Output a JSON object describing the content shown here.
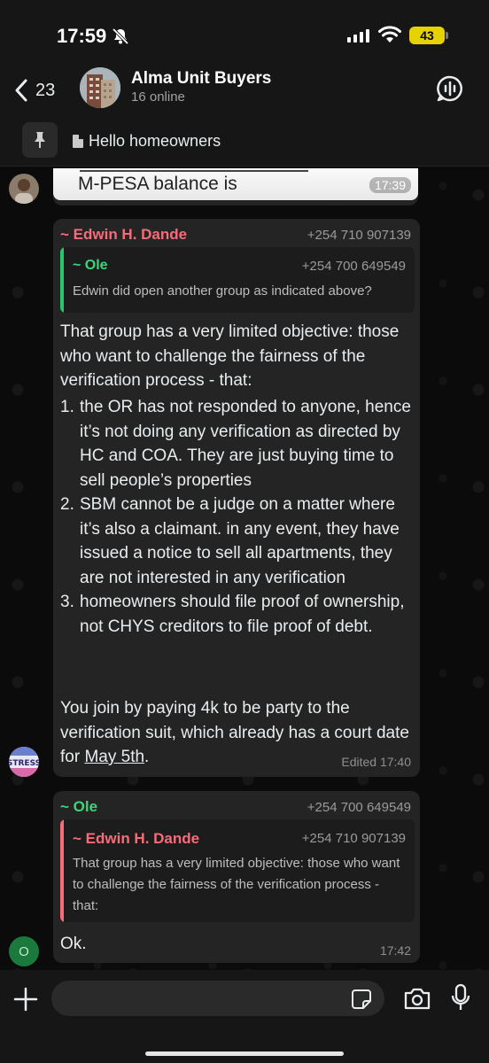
{
  "status_bar": {
    "time": "17:59",
    "battery": "43",
    "battery_color": "#e6d200"
  },
  "header": {
    "back_count": "23",
    "title": "Alma Unit Buyers",
    "subtitle": "16 online",
    "back_icon": "chevron-left-icon",
    "voice_icon": "voice-chat-icon"
  },
  "pinned": {
    "text": "Hello homeowners",
    "icon": "pin-icon"
  },
  "messages": [
    {
      "type": "image",
      "image_text": "M-PESA balance is",
      "time": "17:39"
    },
    {
      "sender": "~ Edwin H. Dande",
      "sender_color": "#f46d7a",
      "phone": "+254 710 907139",
      "quote": {
        "sender": "~ Ole",
        "phone": "+254 700 649549",
        "text": "Edwin did open another group as indicated above?"
      },
      "intro": "That group has a very limited objective: those who want to challenge the fairness of the verification process - that:",
      "items": [
        {
          "num": "1.",
          "text": "the OR has not responded to anyone, hence it’s not doing any verification as directed by HC and COA. They are just buying time to sell people’s properties"
        },
        {
          "num": "2.",
          "text": "SBM cannot be a judge on a matter where it’s also a claimant. in any event, they have issued a notice to sell all apartments, they are not interested in any verification"
        },
        {
          "num": "3.",
          "text": "homeowners should file proof of ownership, not CHYS creditors to file proof of debt."
        }
      ],
      "outro_before": "You join by paying 4k to be party to the verification suit, which already has a court date for ",
      "outro_link": "May 5th",
      "outro_after": ".",
      "meta": "Edited 17:40"
    },
    {
      "sender": "~ Ole",
      "sender_color": "#3ed47a",
      "phone": "+254 700 649549",
      "quote": {
        "sender": "~ Edwin H. Dande",
        "phone": "+254 710 907139",
        "text": "That group has a very limited objective: those who want to challenge the fairness of the verification process - that:"
      },
      "text": "Ok.",
      "time": "17:42",
      "avatar_letter": "O"
    }
  ],
  "avatars": {
    "stress_label": "STRESS"
  },
  "input": {
    "placeholder": ""
  }
}
